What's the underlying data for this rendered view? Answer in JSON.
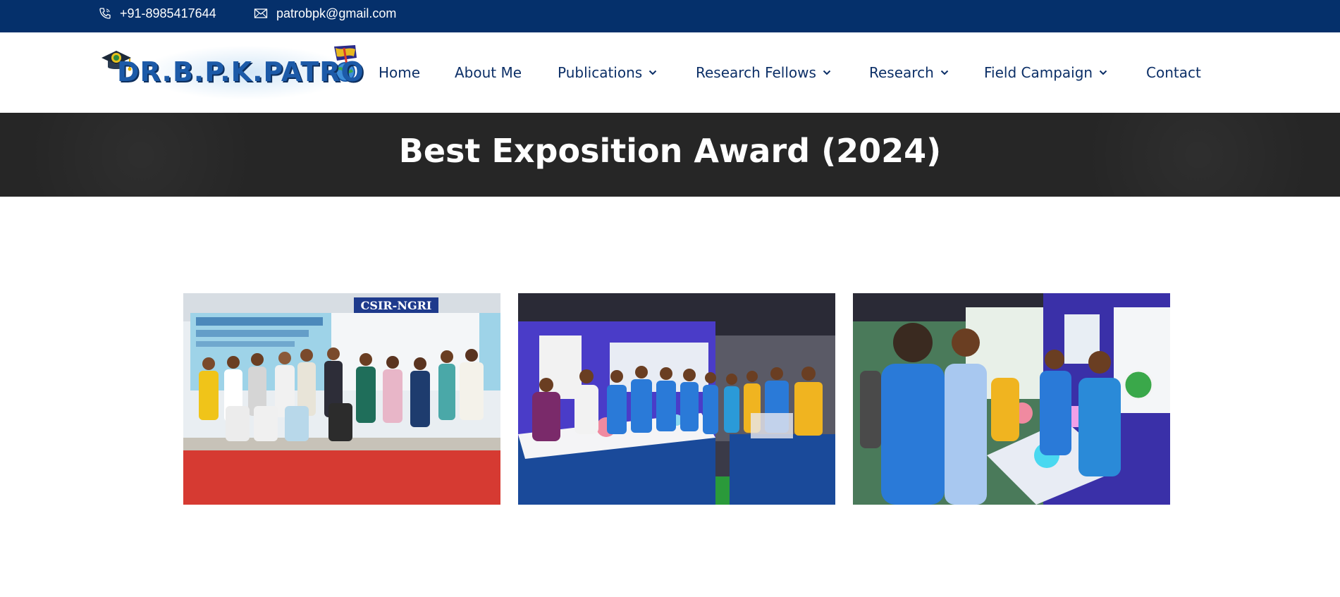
{
  "topbar": {
    "phone": "+91-8985417644",
    "email": "patrobpk@gmail.com",
    "background": "#05306b"
  },
  "logo": {
    "text": "DR.B.P.K.PATRO"
  },
  "nav": {
    "items": [
      {
        "label": "Home",
        "has_dropdown": false
      },
      {
        "label": "About Me",
        "has_dropdown": false
      },
      {
        "label": "Publications",
        "has_dropdown": true
      },
      {
        "label": "Research Fellows",
        "has_dropdown": true
      },
      {
        "label": "Research",
        "has_dropdown": true
      },
      {
        "label": "Field Campaign",
        "has_dropdown": true
      },
      {
        "label": "Contact",
        "has_dropdown": false
      }
    ],
    "color": "#0c2f67"
  },
  "banner": {
    "title": "Best Exposition Award (2024)",
    "background": "#262626"
  },
  "gallery": {
    "photos": [
      {
        "banner_text": "CSIR-NGRI"
      },
      {
        "banner_text": ""
      },
      {
        "banner_text": ""
      }
    ]
  }
}
